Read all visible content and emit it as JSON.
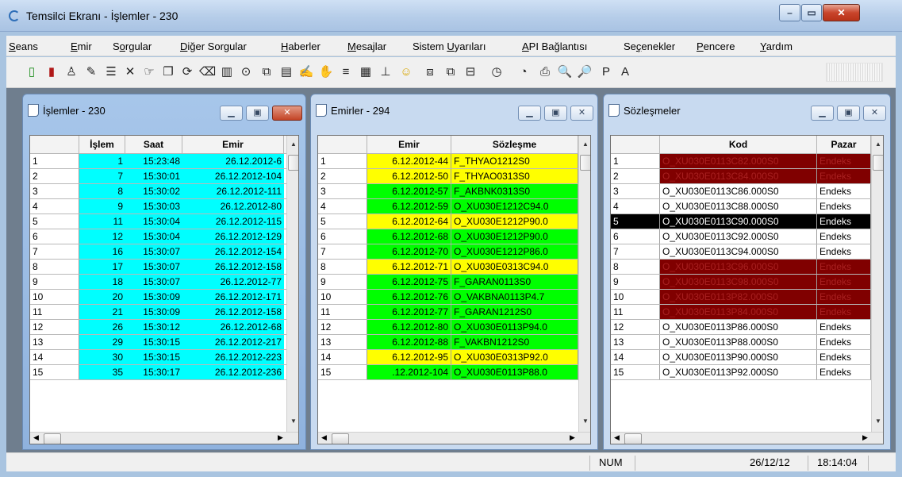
{
  "window": {
    "title": "Temsilci Ekranı - İşlemler - 230",
    "min": "–",
    "max": "▭",
    "close": "✕"
  },
  "menu": [
    {
      "label": "Seans",
      "u": "S",
      "rest": "eans"
    },
    {
      "label": "Emir",
      "u": "E",
      "rest": "mir"
    },
    {
      "label": "Sorgular",
      "pre": "S",
      "u": "o",
      "rest": "rgular"
    },
    {
      "label": "Diğer Sorgular",
      "u": "D",
      "rest": "iğer Sorgular"
    },
    {
      "label": "Haberler",
      "u": "H",
      "rest": "aberler"
    },
    {
      "label": "Mesajlar",
      "u": "M",
      "rest": "esajlar"
    },
    {
      "label": "Sistem Uyarıları",
      "pre": "Sistem ",
      "u": "U",
      "rest": "yarıları"
    },
    {
      "label": "API Bağlantısı",
      "u": "A",
      "rest": "PI Bağlantısı"
    },
    {
      "label": "Seçenekler",
      "pre": "Se",
      "u": "ç",
      "rest": "enekler"
    },
    {
      "label": "Pencere",
      "u": "P",
      "rest": "encere"
    },
    {
      "label": "Yardım",
      "u": "Y",
      "rest": "ardım"
    }
  ],
  "toolbar": [
    "new-doc-icon",
    "red-doc-icon",
    "person-icon",
    "edit-icon",
    "properties-icon",
    "cancel-icon",
    "pointer-icon",
    "copy-icon",
    "refresh-icon",
    "eraser-icon",
    "book-icon",
    "lock-icon",
    "doc-copy-icon",
    "doc-list-icon",
    "signature-icon",
    "hand-icon",
    "align-icon",
    "columns-icon",
    "chart-icon",
    "smiley-icon",
    "export-icon",
    "import-icon",
    "inbox-icon",
    "clock-icon",
    "time-icon",
    "print-icon",
    "zoom-out-icon",
    "zoom-in-icon",
    "font-p-icon",
    "font-a-icon"
  ],
  "toolbar_glyphs": [
    "▯",
    "▮",
    "♙",
    "✎",
    "☰",
    "✕",
    "☞",
    "❐",
    "⟳",
    "⌫",
    "▥",
    "⊙",
    "⧉",
    "▤",
    "✍",
    "✋",
    "≡",
    "▦",
    "⊥",
    "☺",
    "⧈",
    "⧉",
    "⊟",
    "◷",
    "◔",
    "⎙",
    "🔍",
    "🔎",
    "P",
    "A"
  ],
  "islemler": {
    "title": "İşlemler - 230",
    "headers": [
      "",
      "İşlem",
      "Saat",
      "Emir"
    ],
    "rows": [
      [
        "1",
        "1",
        "15:23:48",
        "26.12.2012-6"
      ],
      [
        "2",
        "7",
        "15:30:01",
        "26.12.2012-104"
      ],
      [
        "3",
        "8",
        "15:30:02",
        "26.12.2012-111"
      ],
      [
        "4",
        "9",
        "15:30:03",
        "26.12.2012-80"
      ],
      [
        "5",
        "11",
        "15:30:04",
        "26.12.2012-115"
      ],
      [
        "6",
        "12",
        "15:30:04",
        "26.12.2012-129"
      ],
      [
        "7",
        "16",
        "15:30:07",
        "26.12.2012-154"
      ],
      [
        "8",
        "17",
        "15:30:07",
        "26.12.2012-158"
      ],
      [
        "9",
        "18",
        "15:30:07",
        "26.12.2012-77"
      ],
      [
        "10",
        "20",
        "15:30:09",
        "26.12.2012-171"
      ],
      [
        "11",
        "21",
        "15:30:09",
        "26.12.2012-158"
      ],
      [
        "12",
        "26",
        "15:30:12",
        "26.12.2012-68"
      ],
      [
        "13",
        "29",
        "15:30:15",
        "26.12.2012-217"
      ],
      [
        "14",
        "30",
        "15:30:15",
        "26.12.2012-223"
      ],
      [
        "15",
        "35",
        "15:30:17",
        "26.12.2012-236"
      ]
    ],
    "color": "#00ffff"
  },
  "emirler": {
    "title": "Emirler - 294",
    "headers": [
      "",
      "Emir",
      "Sözleşme"
    ],
    "rows": [
      [
        "1",
        "6.12.2012-44",
        "F_THYAO1212S0",
        "#ffff00"
      ],
      [
        "2",
        "6.12.2012-50",
        "F_THYAO0313S0",
        "#ffff00"
      ],
      [
        "3",
        "6.12.2012-57",
        "F_AKBNK0313S0",
        "#00ff00"
      ],
      [
        "4",
        "6.12.2012-59",
        "O_XU030E1212C94.0",
        "#00ff00"
      ],
      [
        "5",
        "6.12.2012-64",
        "O_XU030E1212P90.0",
        "#ffff00"
      ],
      [
        "6",
        "6.12.2012-68",
        "O_XU030E1212P90.0",
        "#00ff00"
      ],
      [
        "7",
        "6.12.2012-70",
        "O_XU030E1212P86.0",
        "#00ff00"
      ],
      [
        "8",
        "6.12.2012-71",
        "O_XU030E0313C94.0",
        "#ffff00"
      ],
      [
        "9",
        "6.12.2012-75",
        "F_GARAN0113S0",
        "#00ff00"
      ],
      [
        "10",
        "6.12.2012-76",
        "O_VAKBNA0113P4.7",
        "#00ff00"
      ],
      [
        "11",
        "6.12.2012-77",
        "F_GARAN1212S0",
        "#00ff00"
      ],
      [
        "12",
        "6.12.2012-80",
        "O_XU030E0113P94.0",
        "#00ff00"
      ],
      [
        "13",
        "6.12.2012-88",
        "F_VAKBN1212S0",
        "#00ff00"
      ],
      [
        "14",
        "6.12.2012-95",
        "O_XU030E0313P92.0",
        "#ffff00"
      ],
      [
        "15",
        ".12.2012-104",
        "O_XU030E0113P88.0",
        "#00ff00"
      ]
    ]
  },
  "sozlesmeler": {
    "title": "Sözleşmeler",
    "headers": [
      "",
      "Kod",
      "Pazar"
    ],
    "rows": [
      [
        "1",
        "O_XU030E0113C82.000S0",
        "Endeks",
        "#800000"
      ],
      [
        "2",
        "O_XU030E0113C84.000S0",
        "Endeks",
        "#800000"
      ],
      [
        "3",
        "O_XU030E0113C86.000S0",
        "Endeks",
        "#ffffff"
      ],
      [
        "4",
        "O_XU030E0113C88.000S0",
        "Endeks",
        "#ffffff"
      ],
      [
        "5",
        "O_XU030E0113C90.000S0",
        "Endeks",
        "#000000"
      ],
      [
        "6",
        "O_XU030E0113C92.000S0",
        "Endeks",
        "#ffffff"
      ],
      [
        "7",
        "O_XU030E0113C94.000S0",
        "Endeks",
        "#ffffff"
      ],
      [
        "8",
        "O_XU030E0113C96.000S0",
        "Endeks",
        "#800000"
      ],
      [
        "9",
        "O_XU030E0113C98.000S0",
        "Endeks",
        "#800000"
      ],
      [
        "10",
        "O_XU030E0113P82.000S0",
        "Endeks",
        "#800000"
      ],
      [
        "11",
        "O_XU030E0113P84.000S0",
        "Endeks",
        "#800000"
      ],
      [
        "12",
        "O_XU030E0113P86.000S0",
        "Endeks",
        "#ffffff"
      ],
      [
        "13",
        "O_XU030E0113P88.000S0",
        "Endeks",
        "#ffffff"
      ],
      [
        "14",
        "O_XU030E0113P90.000S0",
        "Endeks",
        "#ffffff"
      ],
      [
        "15",
        "O_XU030E0113P92.000S0",
        "Endeks",
        "#ffffff"
      ]
    ]
  },
  "status": {
    "num": "NUM",
    "date": "26/12/12",
    "time": "18:14:04"
  }
}
